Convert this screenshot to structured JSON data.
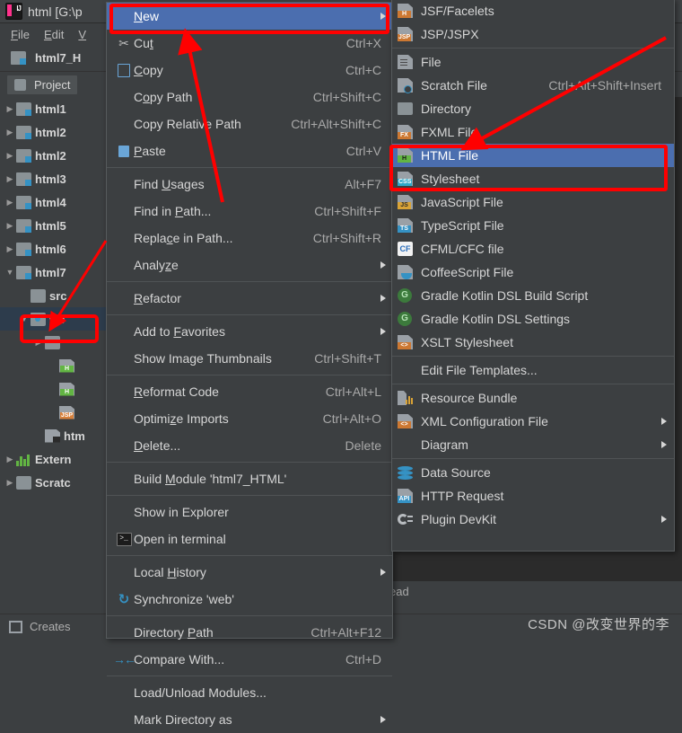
{
  "window": {
    "title": "html [G:\\p",
    "logo_icon": "intellij-idea-logo-icon"
  },
  "menubar": {
    "items": [
      "File",
      "Edit",
      "V"
    ]
  },
  "project_header": {
    "module_label": "html7_H",
    "module_icon": "module-folder-icon"
  },
  "tool_window": {
    "tab_label": "Project",
    "tab_icon": "project-tool-window-icon"
  },
  "tree": {
    "items": [
      {
        "label": "html1",
        "icon": "module-folder-icon",
        "expander": "collapsed",
        "indent": 0,
        "selected": false
      },
      {
        "label": "html2",
        "icon": "module-folder-icon",
        "expander": "collapsed",
        "indent": 0,
        "selected": false
      },
      {
        "label": "html2",
        "icon": "module-folder-icon",
        "expander": "collapsed",
        "indent": 0,
        "selected": false
      },
      {
        "label": "html3",
        "icon": "module-folder-icon",
        "expander": "collapsed",
        "indent": 0,
        "selected": false
      },
      {
        "label": "html4",
        "icon": "module-folder-icon",
        "expander": "collapsed",
        "indent": 0,
        "selected": false
      },
      {
        "label": "html5",
        "icon": "module-folder-icon",
        "expander": "collapsed",
        "indent": 0,
        "selected": false
      },
      {
        "label": "html6",
        "icon": "module-folder-icon",
        "expander": "collapsed",
        "indent": 0,
        "selected": false
      },
      {
        "label": "html7",
        "icon": "module-folder-icon",
        "expander": "expanded",
        "indent": 0,
        "selected": false
      },
      {
        "label": "src",
        "icon": "folder-icon",
        "expander": "none",
        "indent": 1,
        "selected": false
      },
      {
        "label": "we",
        "icon": "web-folder-icon",
        "expander": "expanded",
        "indent": 1,
        "selected": true
      },
      {
        "label": "",
        "icon": "folder-icon",
        "expander": "collapsed",
        "indent": 2,
        "selected": false
      },
      {
        "label": "",
        "icon": "html-file-icon",
        "expander": "none",
        "indent": 3,
        "selected": false
      },
      {
        "label": "",
        "icon": "html-file-icon",
        "expander": "none",
        "indent": 3,
        "selected": false
      },
      {
        "label": "",
        "icon": "jsp-file-icon",
        "expander": "none",
        "indent": 3,
        "selected": false
      },
      {
        "label": "htm",
        "icon": "iml-file-icon",
        "expander": "none",
        "indent": 2,
        "selected": false
      },
      {
        "label": "Extern",
        "icon": "external-libraries-icon",
        "expander": "collapsed",
        "indent": 0,
        "selected": false
      },
      {
        "label": "Scratc",
        "icon": "scratches-icon",
        "expander": "collapsed",
        "indent": 0,
        "selected": false
      }
    ]
  },
  "context_menu": {
    "items": [
      {
        "label": "New",
        "accel": "",
        "icon": "",
        "submenu": true,
        "selected": true,
        "mnemonic": "N",
        "highlighted_box": true
      },
      {
        "label": "Cut",
        "accel": "Ctrl+X",
        "icon": "scissors-icon",
        "submenu": false,
        "mnemonic": "t"
      },
      {
        "label": "Copy",
        "accel": "Ctrl+C",
        "icon": "copy-icon",
        "submenu": false,
        "mnemonic": "C"
      },
      {
        "label": "Copy Path",
        "accel": "Ctrl+Shift+C",
        "icon": "",
        "submenu": false,
        "mnemonic": "o"
      },
      {
        "label": "Copy Relative Path",
        "accel": "Ctrl+Alt+Shift+C",
        "icon": "",
        "submenu": false
      },
      {
        "label": "Paste",
        "accel": "Ctrl+V",
        "icon": "paste-icon",
        "submenu": false,
        "mnemonic": "P"
      },
      {
        "separator": true
      },
      {
        "label": "Find Usages",
        "accel": "Alt+F7",
        "icon": "",
        "submenu": false,
        "mnemonic": "U"
      },
      {
        "label": "Find in Path...",
        "accel": "Ctrl+Shift+F",
        "icon": "",
        "submenu": false,
        "mnemonic": "P"
      },
      {
        "label": "Replace in Path...",
        "accel": "Ctrl+Shift+R",
        "icon": "",
        "submenu": false,
        "mnemonic": "c"
      },
      {
        "label": "Analyze",
        "accel": "",
        "icon": "",
        "submenu": true,
        "mnemonic": "z"
      },
      {
        "separator": true
      },
      {
        "label": "Refactor",
        "accel": "",
        "icon": "",
        "submenu": true,
        "mnemonic": "R"
      },
      {
        "separator": true
      },
      {
        "label": "Add to Favorites",
        "accel": "",
        "icon": "",
        "submenu": true,
        "mnemonic": "F"
      },
      {
        "label": "Show Image Thumbnails",
        "accel": "Ctrl+Shift+T",
        "icon": "",
        "submenu": false
      },
      {
        "separator": true
      },
      {
        "label": "Reformat Code",
        "accel": "Ctrl+Alt+L",
        "icon": "",
        "submenu": false,
        "mnemonic": "R"
      },
      {
        "label": "Optimize Imports",
        "accel": "Ctrl+Alt+O",
        "icon": "",
        "submenu": false,
        "mnemonic": "z"
      },
      {
        "label": "Delete...",
        "accel": "Delete",
        "icon": "",
        "submenu": false,
        "mnemonic": "D"
      },
      {
        "separator": true
      },
      {
        "label": "Build Module 'html7_HTML'",
        "accel": "",
        "icon": "",
        "submenu": false,
        "mnemonic": "M"
      },
      {
        "separator": true
      },
      {
        "label": "Show in Explorer",
        "accel": "",
        "icon": "",
        "submenu": false
      },
      {
        "label": "Open in terminal",
        "accel": "",
        "icon": "terminal-icon",
        "submenu": false
      },
      {
        "separator": true
      },
      {
        "label": "Local History",
        "accel": "",
        "icon": "",
        "submenu": true,
        "mnemonic": "H"
      },
      {
        "label": "Synchronize 'web'",
        "accel": "",
        "icon": "synchronize-icon",
        "submenu": false
      },
      {
        "separator": true
      },
      {
        "label": "Directory Path",
        "accel": "Ctrl+Alt+F12",
        "icon": "",
        "submenu": false,
        "mnemonic": "P"
      },
      {
        "label": "Compare With...",
        "accel": "Ctrl+D",
        "icon": "compare-icon",
        "submenu": false
      },
      {
        "separator": true
      },
      {
        "label": "Load/Unload Modules...",
        "accel": "",
        "icon": "",
        "submenu": false
      },
      {
        "label": "Mark Directory as",
        "accel": "",
        "icon": "",
        "submenu": true
      }
    ]
  },
  "submenu": {
    "items": [
      {
        "label": "JSF/Facelets",
        "accel": "",
        "icon": "file-icon",
        "tag": "H",
        "tag_style": "t-h",
        "submenu": false
      },
      {
        "label": "JSP/JSPX",
        "accel": "",
        "icon": "file-icon",
        "tag": "JSP",
        "tag_style": "t-jsp",
        "submenu": false
      },
      {
        "separator": true
      },
      {
        "label": "File",
        "accel": "",
        "icon": "plain-file-icon",
        "submenu": false
      },
      {
        "label": "Scratch File",
        "accel": "Ctrl+Alt+Shift+Insert",
        "icon": "scratch-file-icon",
        "submenu": false
      },
      {
        "label": "Directory",
        "accel": "",
        "icon": "folder-icon",
        "submenu": false
      },
      {
        "label": "FXML File",
        "accel": "",
        "icon": "file-icon",
        "tag": "FX",
        "tag_style": "t-fxml",
        "submenu": false
      },
      {
        "label": "HTML File",
        "accel": "",
        "icon": "file-icon",
        "tag": "H",
        "tag_style": "t-hgreen",
        "submenu": false,
        "selected": true,
        "highlighted_box": true
      },
      {
        "label": "Stylesheet",
        "accel": "",
        "icon": "file-icon",
        "tag": "CSS",
        "tag_style": "t-css",
        "submenu": false
      },
      {
        "label": "JavaScript File",
        "accel": "",
        "icon": "file-icon",
        "tag": "JS",
        "tag_style": "t-js",
        "submenu": false
      },
      {
        "label": "TypeScript File",
        "accel": "",
        "icon": "file-icon",
        "tag": "TS",
        "tag_style": "t-ts",
        "submenu": false
      },
      {
        "label": "CFML/CFC file",
        "accel": "",
        "icon": "cfml-icon",
        "submenu": false
      },
      {
        "label": "CoffeeScript File",
        "accel": "",
        "icon": "coffeescript-icon",
        "submenu": false
      },
      {
        "label": "Gradle Kotlin DSL Build Script",
        "accel": "",
        "icon": "gradle-icon",
        "submenu": false
      },
      {
        "label": "Gradle Kotlin DSL Settings",
        "accel": "",
        "icon": "gradle-icon",
        "submenu": false
      },
      {
        "label": "XSLT Stylesheet",
        "accel": "",
        "icon": "file-icon",
        "tag": "<>",
        "tag_style": "t-xslt",
        "submenu": false
      },
      {
        "separator": true
      },
      {
        "label": "Edit File Templates...",
        "accel": "",
        "icon": "",
        "submenu": false
      },
      {
        "separator": true
      },
      {
        "label": "Resource Bundle",
        "accel": "",
        "icon": "resource-bundle-icon",
        "submenu": false
      },
      {
        "label": "XML Configuration File",
        "accel": "",
        "icon": "file-icon",
        "tag": "<>",
        "tag_style": "t-xslt",
        "submenu": true
      },
      {
        "label": "Diagram",
        "accel": "",
        "icon": "",
        "submenu": true
      },
      {
        "separator": true
      },
      {
        "label": "Data Source",
        "accel": "",
        "icon": "data-source-icon",
        "submenu": false
      },
      {
        "label": "HTTP Request",
        "accel": "",
        "icon": "file-icon",
        "tag": "API",
        "tag_style": "t-api",
        "submenu": false
      },
      {
        "label": "Plugin DevKit",
        "accel": "",
        "icon": "plugin-devkit-icon",
        "submenu": true
      }
    ]
  },
  "breadcrumb": {
    "text": "ead"
  },
  "status_bar": {
    "text": "Creates",
    "icon": "create-file-icon"
  },
  "watermark": {
    "text": "CSDN @改变世界的李"
  },
  "annotations": {
    "highlight_color": "#FF0000",
    "arrow_color": "#FF0000",
    "boxes": [
      "new-menu-item",
      "html-file-item",
      "web-folder-node"
    ],
    "arrows": [
      "arrow-to-new",
      "arrow-to-html-file",
      "arrow-to-web-folder"
    ]
  },
  "colors": {
    "menu_bg": "#3C3F41",
    "menu_selected": "#4B6EAF",
    "editor_bg": "#2B2B2B",
    "text": "#D6D6D6",
    "accel_text": "#A9A9A9",
    "separator": "#4F5355",
    "tree_selected": "#2D3C4C"
  }
}
